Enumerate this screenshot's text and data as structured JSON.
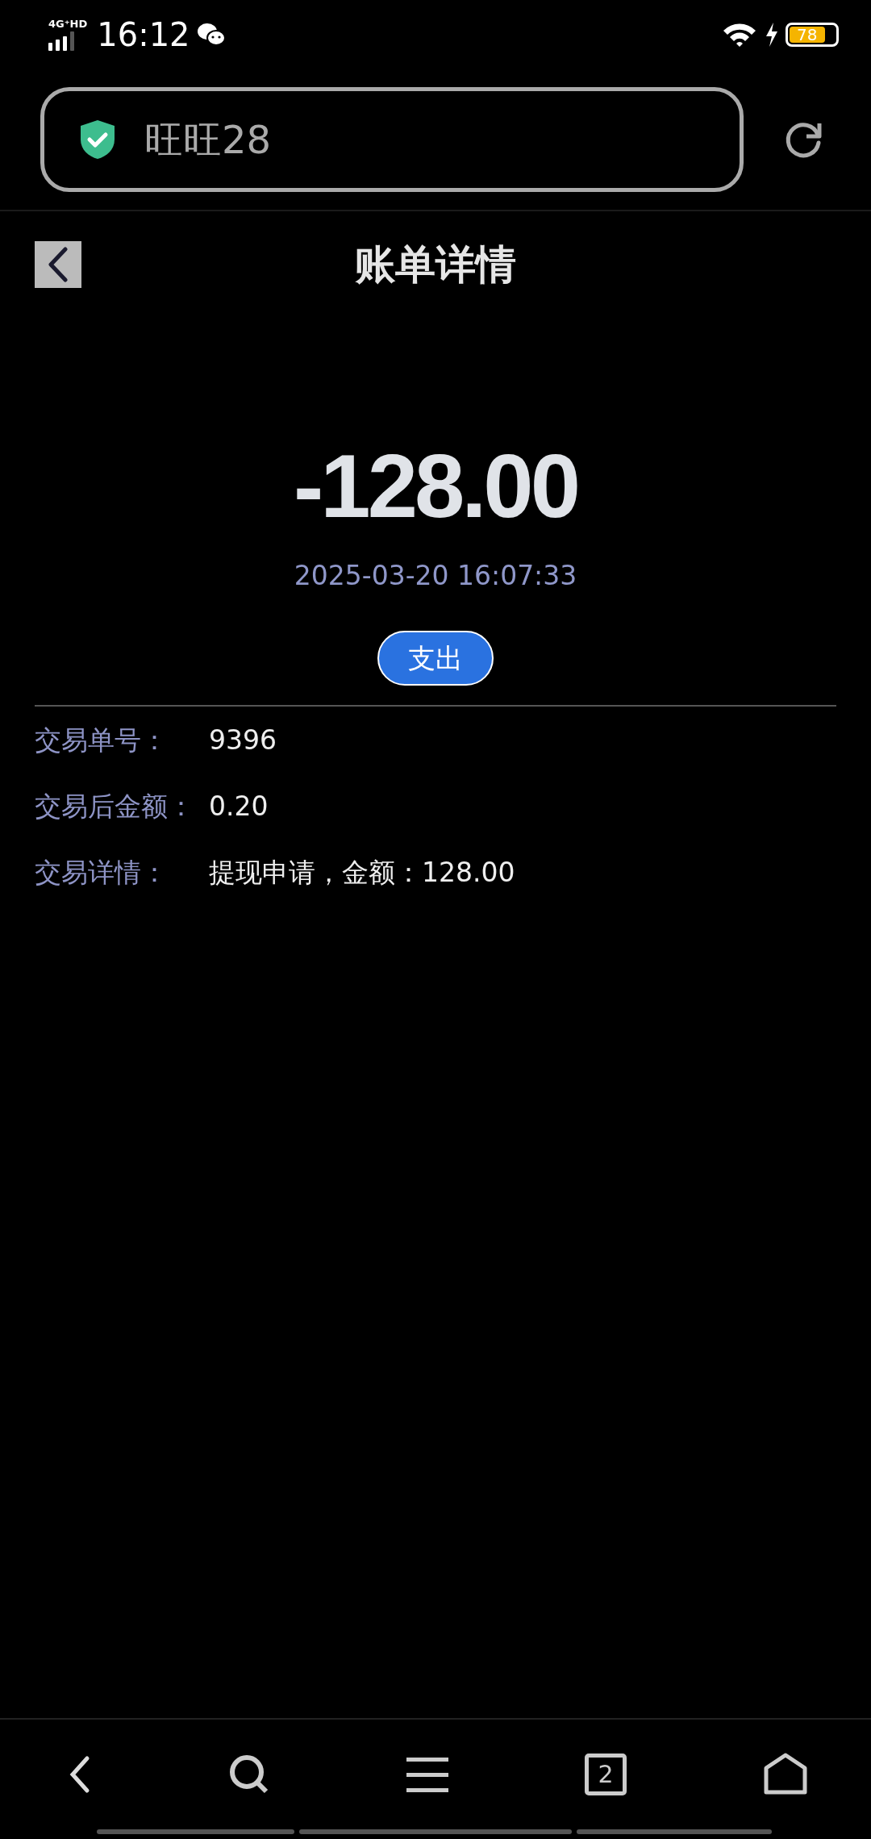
{
  "status_bar": {
    "network": "4G⁺HD",
    "time": "16:12",
    "battery": "78"
  },
  "address_bar": {
    "text": "旺旺28"
  },
  "header": {
    "title": "账单详情"
  },
  "amount": "-128.00",
  "datetime": "2025-03-20 16:07:33",
  "type_badge": "支出",
  "details": [
    {
      "label": "交易单号：",
      "value": "9396"
    },
    {
      "label": "交易后金额：",
      "value": "0.20"
    },
    {
      "label": "交易详情：",
      "value": "提现申请，金额：128.00"
    }
  ],
  "bottom_nav": {
    "tab_count": "2"
  }
}
